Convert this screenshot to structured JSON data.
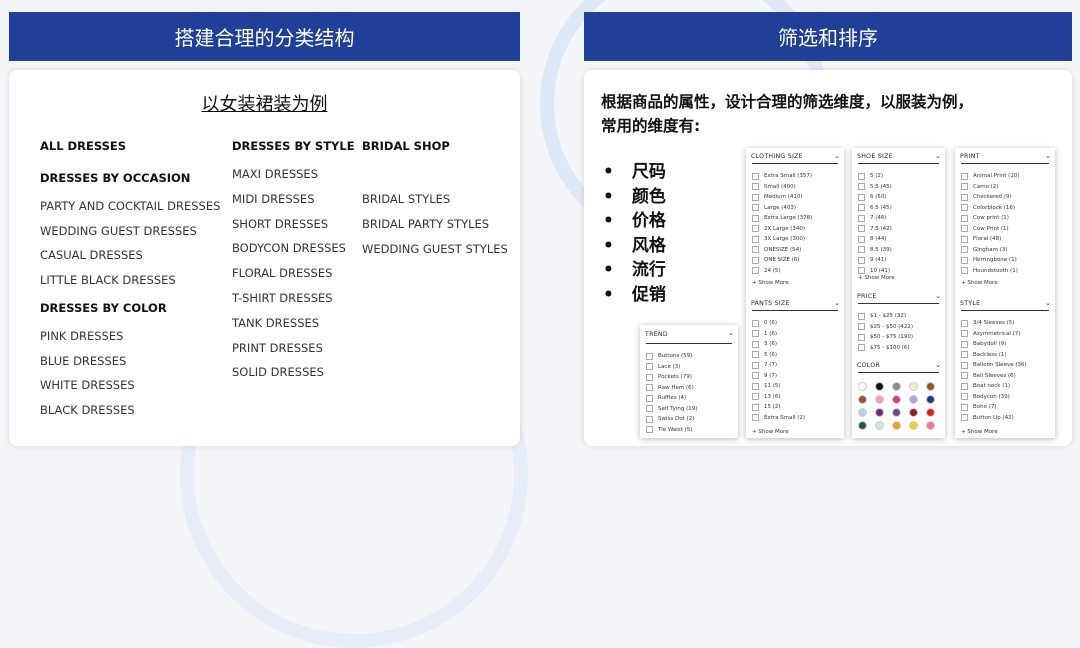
{
  "left": {
    "header": "搭建合理的分类结构",
    "subtitle": "以女装裙装为例",
    "col1": {
      "all": "ALL DRESSES",
      "occasion_title": "DRESSES BY OCCASION",
      "occasion_items": [
        "PARTY AND COCKTAIL DRESSES",
        "WEDDING GUEST DRESSES",
        "CASUAL DRESSES",
        "LITTLE BLACK DRESSES"
      ],
      "color_title": "DRESSES BY COLOR",
      "color_items": [
        "PINK DRESSES",
        "BLUE DRESSES",
        "WHITE DRESSES",
        "BLACK DRESSES"
      ]
    },
    "col2": {
      "title": "DRESSES BY STYLE",
      "items": [
        "MAXI DRESSES",
        "MIDI DRESSES",
        "SHORT DRESSES",
        "BODYCON DRESSES",
        "FLORAL DRESSES",
        "T-SHIRT DRESSES",
        "TANK DRESSES",
        "PRINT DRESSES",
        "SOLID DRESSES"
      ]
    },
    "col3": {
      "title": "BRIDAL SHOP",
      "items": [
        "BRIDAL STYLES",
        "BRIDAL PARTY STYLES",
        "WEDDING GUEST STYLES"
      ]
    }
  },
  "right": {
    "header": "筛选和排序",
    "intro_line1": "根据商品的属性，设计合理的筛选维度，以服装为例，",
    "intro_line2": "常用的维度有:",
    "bullets": [
      "尺码",
      "颜色",
      "价格",
      "风格",
      "流行",
      "促销"
    ],
    "show_more": "Show More",
    "panels": {
      "trend": {
        "title": "TREND",
        "options": [
          "Buttons (59)",
          "Lace (3)",
          "Pockets (79)",
          "Raw Hem (6)",
          "Ruffles (4)",
          "Self Tying (19)",
          "Swiss Dot (2)",
          "Tie Waist (5)"
        ]
      },
      "clothing_size": {
        "title": "CLOTHING SIZE",
        "options": [
          "Extra Small (357)",
          "Small (400)",
          "Medium (410)",
          "Large (403)",
          "Extra Large (378)",
          "2X Large (340)",
          "3X Large (300)",
          "ONESIZE (54)",
          "ONE SIZE (6)",
          "24 (5)"
        ]
      },
      "pants_size": {
        "title": "PANTS SIZE",
        "options": [
          "0 (6)",
          "1 (6)",
          "3 (6)",
          "5 (6)",
          "7 (7)",
          "9 (7)",
          "11 (5)",
          "13 (6)",
          "15 (2)",
          "Extra Small (2)"
        ]
      },
      "shoe_size": {
        "title": "SHOE SIZE",
        "options": [
          "5 (2)",
          "5.5 (45)",
          "6 (50)",
          "6.5 (45)",
          "7 (46)",
          "7.5 (42)",
          "8 (44)",
          "8.5 (39)",
          "9 (41)",
          "10 (41)"
        ]
      },
      "price": {
        "title": "PRICE",
        "options": [
          "$1 - $25 (32)",
          "$25 - $50 (422)",
          "$50 - $75 (190)",
          "$75 - $100 (6)"
        ]
      },
      "color": {
        "title": "COLOR",
        "swatches": [
          "#ffffff",
          "#111111",
          "#8c8c8c",
          "#f1ead8",
          "#8b5a2b",
          "#a0522d",
          "#f4a0b5",
          "#d63a8e",
          "#c59ad9",
          "#1e3a8a",
          "#b7d3ee",
          "#6b2d8a",
          "#6b4b8c",
          "#8b1a2b",
          "#e02020",
          "#1e5a3a",
          "#cfe8dc",
          "#f0a020",
          "#f5d020",
          "#ff6fa0"
        ]
      },
      "print": {
        "title": "PRINT",
        "options": [
          "Animal Print (20)",
          "Camo (2)",
          "Checkered (9)",
          "Colorblock (16)",
          "Cow print (1)",
          "Cow Print (1)",
          "Floral (48)",
          "Gingham (3)",
          "Herringbone (1)",
          "Houndstooth (1)"
        ]
      },
      "style": {
        "title": "STYLE",
        "options": [
          "3/4 Sleeves (5)",
          "Asymmetrical (7)",
          "Babydoll (9)",
          "Backless (1)",
          "Balloon Sleeve (36)",
          "Bell Sleeves (6)",
          "Boat neck (1)",
          "Bodycon (39)",
          "Boho (7)",
          "Button Up (42)"
        ]
      }
    }
  }
}
